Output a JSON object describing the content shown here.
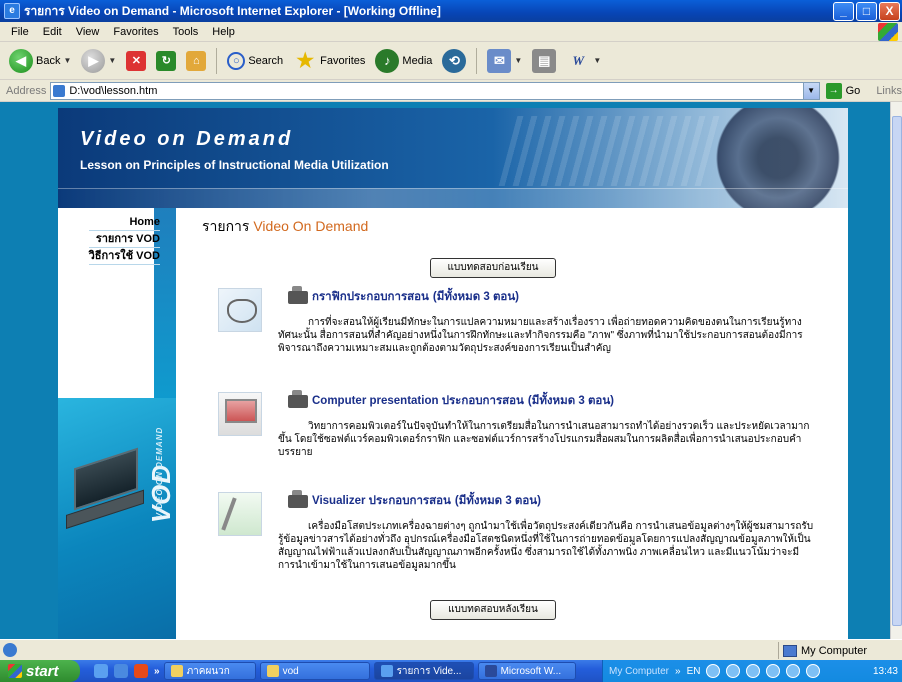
{
  "window": {
    "title": "รายการ Video on Demand - Microsoft Internet Explorer - [Working Offline]",
    "buttons": [
      "_",
      "□",
      "X"
    ]
  },
  "menu": [
    "File",
    "Edit",
    "View",
    "Favorites",
    "Tools",
    "Help"
  ],
  "toolbar": {
    "back_label": "Back",
    "search_label": "Search",
    "favorites_label": "Favorites",
    "media_label": "Media"
  },
  "address": {
    "label": "Address",
    "value": "D:\\vod\\lesson.htm",
    "go_label": "Go",
    "links_label": "Links"
  },
  "banner": {
    "title": "Video on Demand",
    "subtitle": "Lesson on Principles of Instructional Media Utilization"
  },
  "sidebar": {
    "items": [
      {
        "label": "Home"
      },
      {
        "label": "รายการ VOD"
      },
      {
        "label": "วิธีการใช้ VOD"
      }
    ],
    "vod_big": "VOD",
    "vod_small": "VIDEO ON DEMAND"
  },
  "main": {
    "heading_prefix": "รายการ ",
    "heading_v": "Video ",
    "heading_on": "On ",
    "heading_d": "Demand",
    "pretest_button": "แบบทดสอบก่อนเรียน",
    "posttest_button": "แบบทดสอบหลังเรียน",
    "lessons": [
      {
        "title": "กราฟิกประกอบการสอน",
        "count": "(มีทั้งหมด 3 ตอน)",
        "description": "การที่จะสอนให้ผู้เรียนมีทักษะในการแปลความหมายและสร้างเรื่องราว เพื่อถ่ายทอดความคิดของตนในการเรียนรู้ทางทัศนะนั้น สื่อการสอนที่สำคัญอย่างหนึ่งในการฝึกทักษะและทำกิจกรรมคือ \"ภาพ\" ซึ่งภาพที่นำมาใช้ประกอบการสอนต้องมีการพิจารณาถึงความเหมาะสมและถูกต้องตามวัตถุประสงค์ของการเรียนเป็นสำคัญ"
      },
      {
        "title": "Computer presentation ประกอบการสอน",
        "count": "(มีทั้งหมด 3 ตอน)",
        "description": "วิทยาการคอมพิวเตอร์ในปัจจุบันทำให้ในการเตรียมสื่อในการนำเสนอสามารถทำได้อย่างรวดเร็ว และประหยัดเวลามากขึ้น โดยใช้ซอฟต์แวร์คอมพิวเตอร์กราฟิก และซอฟต์แวร์การสร้างโปรแกรมสื่อผสมในการผลิตสื่อเพื่อการนำเสนอประกอบคำบรรยาย"
      },
      {
        "title": "Visualizer ประกอบการสอน",
        "count": "(มีทั้งหมด 3 ตอน)",
        "description": "เครื่องมือโสตประเภทเครื่องฉายต่างๆ ถูกนำมาใช้เพื่อวัตถุประสงค์เดียวกันคือ การนำเสนอข้อมูลต่างๆให้ผู้ชมสามารถรับรู้ข้อมูลข่าวสารได้อย่างทั่วถึง อุปกรณ์เครื่องมือโสตชนิดหนึ่งที่ใช้ในการถ่ายทอดข้อมูลโดยการแปลงสัญญาณข้อมูลภาพให้เป็นสัญญาณไฟฟ้าแล้วแปลงกลับเป็นสัญญาณภาพอีกครั้งหนึ่ง ซึ่งสามารถใช้ได้ทั้งภาพนิ่ง ภาพเคลื่อนไหว และมีแนวโน้มว่าจะมีการนำเข้ามาใช้ในการเสนอข้อมูลมากขึ้น"
      }
    ]
  },
  "status": {
    "zone": "My Computer"
  },
  "taskbar": {
    "start_label": "start",
    "tasks": [
      {
        "label": "ภาคผนวก"
      },
      {
        "label": "vod"
      },
      {
        "label": "รายการ Vide..."
      },
      {
        "label": "Microsoft W..."
      }
    ],
    "tray_mycomputer": "My Computer",
    "tray_lang": "EN",
    "clock": "13:43"
  }
}
